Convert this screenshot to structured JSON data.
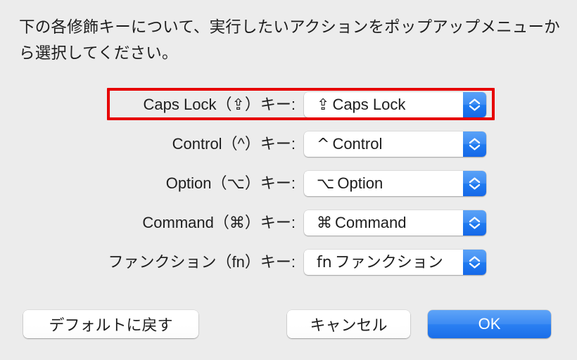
{
  "dialog": {
    "description": "下の各修飾キーについて、実行したいアクションをポップアップメニューから選択してください。"
  },
  "highlight": {
    "color": "#e60000",
    "target": "caps-lock-row"
  },
  "rows": [
    {
      "id": "caps-lock",
      "label": "Caps Lock（⇪）キー:",
      "selected_glyph": "⇪",
      "selected_text": "Caps Lock",
      "highlighted": true
    },
    {
      "id": "control",
      "label": "Control（^）キー:",
      "selected_glyph": "^",
      "selected_text": "Control",
      "highlighted": false
    },
    {
      "id": "option",
      "label": "Option（⌥）キー:",
      "selected_glyph": "⌥",
      "selected_text": "Option",
      "highlighted": false
    },
    {
      "id": "command",
      "label": "Command（⌘）キー:",
      "selected_glyph": "⌘",
      "selected_text": "Command",
      "highlighted": false
    },
    {
      "id": "function",
      "label": "ファンクション（fn）キー:",
      "selected_glyph": "fn",
      "selected_text": "ファンクション",
      "highlighted": false
    }
  ],
  "buttons": {
    "restore_defaults": "デフォルトに戻す",
    "cancel": "キャンセル",
    "ok": "OK"
  },
  "colors": {
    "background": "#ececec",
    "accent_blue": "#2b80f2",
    "highlight_red": "#e60000",
    "text": "#1d1d1d"
  }
}
